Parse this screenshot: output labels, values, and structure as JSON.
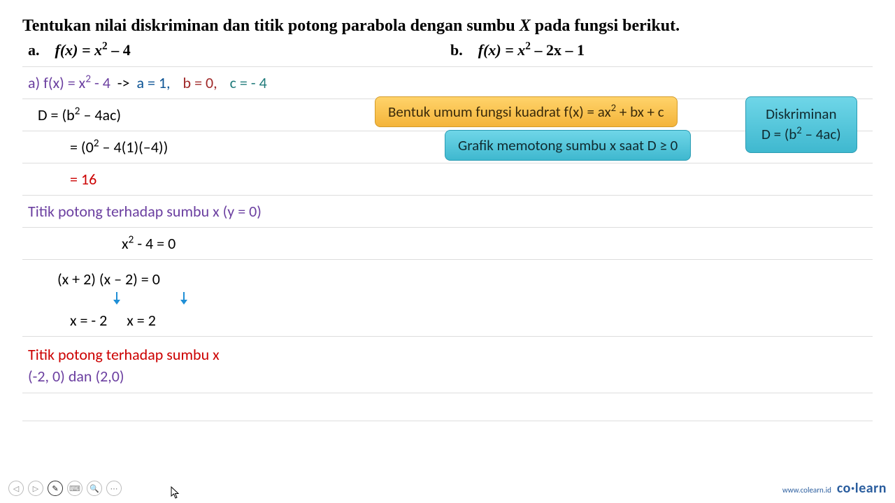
{
  "title_prefix": "Tentukan nilai diskriminan dan titik potong parabola dengan sumbu ",
  "title_var": "X",
  "title_suffix": " pada fungsi berikut.",
  "problems": {
    "a_label": "a.",
    "a_fx": "f(x) = x",
    "a_after": " – 4",
    "b_label": "b.",
    "b_fx": "f(x) = x",
    "b_after": " – 2x – 1"
  },
  "work": {
    "l1_a": "a) f(x) = x",
    "l1_a2": " - 4",
    "l1_arrow": "  ->  ",
    "l1_vals": {
      "a": "a = 1,",
      "b": "b = 0,",
      "c": "c = - 4"
    },
    "l2": "D = (b",
    "l2_tail": " – 4ac)",
    "l3a": "= (0",
    "l3b": " – 4(1)(–4))",
    "l4": "= 16",
    "l5": "Titik potong terhadap sumbu x (y = 0)",
    "l6a": "x",
    "l6b": " - 4 = 0",
    "l7": "(x + 2) (x – 2) = 0",
    "l8a": "x = - 2",
    "l8b": "x = 2",
    "l9": "Titik potong terhadap sumbu x",
    "l10": "(-2, 0) dan (2,0)"
  },
  "callouts": {
    "general_form_a": "Bentuk umum fungsi kuadrat f(x) = ax",
    "general_form_b": " + bx + c",
    "graph_cond": "Grafik memotong sumbu x saat D ≥ 0",
    "disk_label": "Diskriminan",
    "disk_eq_a": "D = (b",
    "disk_eq_b": " – 4ac)"
  },
  "footer": {
    "tools": [
      "◁",
      "▷",
      "✎",
      "⌨",
      "🔍",
      "⋯"
    ],
    "url": "www.colearn.id",
    "logo_a": "co",
    "logo_dot": "·",
    "logo_b": "learn"
  }
}
